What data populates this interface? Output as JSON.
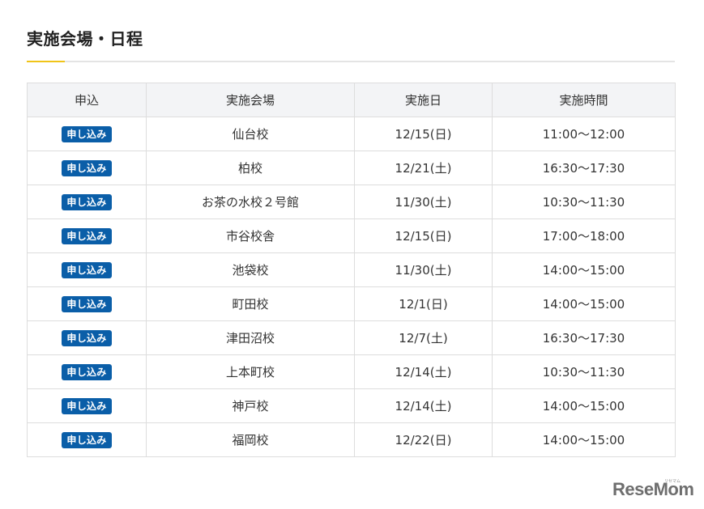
{
  "section": {
    "title": "実施会場・日程"
  },
  "table": {
    "headers": [
      "申込",
      "実施会場",
      "実施日",
      "実施時間"
    ],
    "apply_label": "申し込み",
    "rows": [
      {
        "venue": "仙台校",
        "date": "12/15(日)",
        "time": "11:00～12:00"
      },
      {
        "venue": "柏校",
        "date": "12/21(土)",
        "time": "16:30～17:30"
      },
      {
        "venue": "お茶の水校２号館",
        "date": "11/30(土)",
        "time": "10:30～11:30"
      },
      {
        "venue": "市谷校舎",
        "date": "12/15(日)",
        "time": "17:00～18:00"
      },
      {
        "venue": "池袋校",
        "date": "11/30(土)",
        "time": "14:00～15:00"
      },
      {
        "venue": "町田校",
        "date": "12/1(日)",
        "time": "14:00～15:00"
      },
      {
        "venue": "津田沼校",
        "date": "12/7(土)",
        "time": "16:30～17:30"
      },
      {
        "venue": "上本町校",
        "date": "12/14(土)",
        "time": "10:30～11:30"
      },
      {
        "venue": "神戸校",
        "date": "12/14(土)",
        "time": "14:00～15:00"
      },
      {
        "venue": "福岡校",
        "date": "12/22(日)",
        "time": "14:00～15:00"
      }
    ]
  },
  "watermark": {
    "logo_text": "ReseMom",
    "kana": "リセマム"
  },
  "colors": {
    "button_bg": "#0a5ea8",
    "accent": "#f0c419",
    "header_bg": "#f3f4f6"
  }
}
